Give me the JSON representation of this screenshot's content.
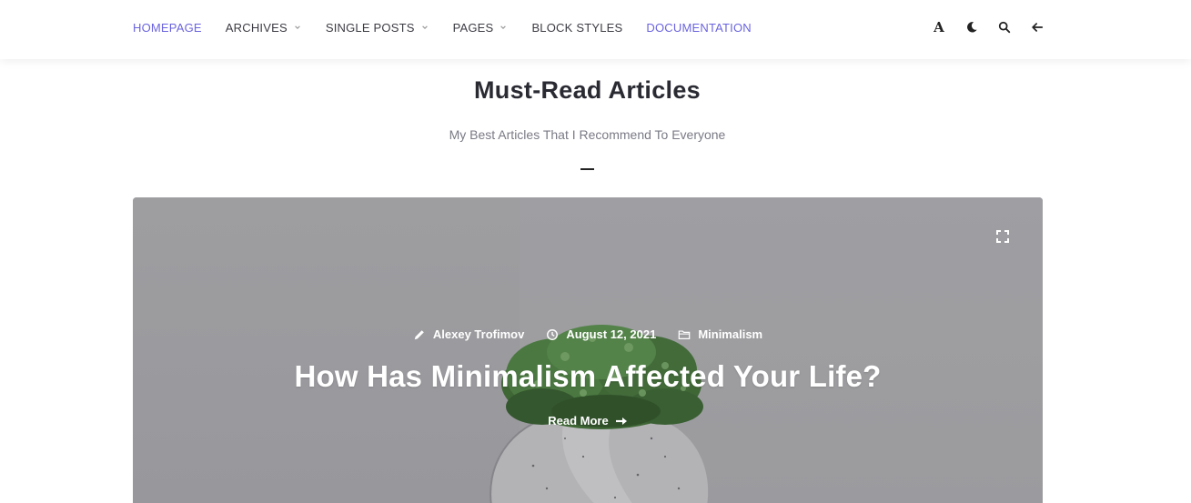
{
  "nav": {
    "items": [
      {
        "label": "HOMEPAGE",
        "active": true,
        "dropdown": false
      },
      {
        "label": "ARCHIVES",
        "active": false,
        "dropdown": true
      },
      {
        "label": "SINGLE POSTS",
        "active": false,
        "dropdown": true
      },
      {
        "label": "PAGES",
        "active": false,
        "dropdown": true
      },
      {
        "label": "BLOCK STYLES",
        "active": false,
        "dropdown": false
      },
      {
        "label": "DOCUMENTATION",
        "active": true,
        "dropdown": false
      }
    ],
    "tools": [
      "font-size-icon",
      "dark-mode-moon-icon",
      "search-icon",
      "back-arrow-icon"
    ],
    "tool_font_glyph": "A"
  },
  "section": {
    "title": "Must-Read Articles",
    "subtitle": "My Best Articles That I Recommend To Everyone"
  },
  "featured_post": {
    "author": "Alexey Trofimov",
    "date": "August 12, 2021",
    "category": "Minimalism",
    "title": "How Has Minimalism Affected Your Life?",
    "read_more": "Read More",
    "icons": {
      "author": "pencil-icon",
      "date": "clock-icon",
      "category": "folder-icon",
      "expand": "expand-icon",
      "read_more": "arrow-right-icon"
    }
  },
  "colors": {
    "accent": "#6b64de",
    "text_dark": "#2a2a33",
    "subtitle": "#7a7a86"
  }
}
